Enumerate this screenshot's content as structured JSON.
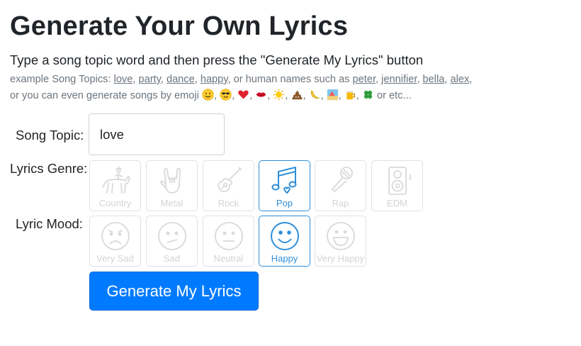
{
  "page": {
    "title": "Generate Your Own Lyrics",
    "instruction": "Type a song topic word and then press the \"Generate My Lyrics\" button",
    "examples_prefix": "example Song Topics:",
    "example_topics": [
      "love",
      "party",
      "dance",
      "happy"
    ],
    "human_names_text": ", or human names such as",
    "example_names": [
      "peter",
      "jennifier",
      "bella",
      "alex"
    ],
    "emoji_text": "or you can even generate songs by emoji",
    "emoji_names": [
      "smiling-face-emoji",
      "sunglasses-face-emoji",
      "heart-emoji",
      "lips-emoji",
      "sun-emoji",
      "poop-emoji",
      "banana-emoji",
      "beach-emoji",
      "beer-emoji",
      "four-leaf-clover-emoji"
    ],
    "etc_text": "or etc..."
  },
  "form": {
    "topic_label": "Song Topic:",
    "topic_value": "love",
    "genre_label": "Lyrics Genre:",
    "genres": [
      {
        "label": "Country",
        "icon": "cowboy-horse-icon",
        "selected": false
      },
      {
        "label": "Metal",
        "icon": "rock-hand-icon",
        "selected": false
      },
      {
        "label": "Rock",
        "icon": "guitar-icon",
        "selected": false
      },
      {
        "label": "Pop",
        "icon": "music-notes-icon",
        "selected": true
      },
      {
        "label": "Rap",
        "icon": "microphone-icon",
        "selected": false
      },
      {
        "label": "EDM",
        "icon": "speaker-icon",
        "selected": false
      }
    ],
    "mood_label": "Lyric Mood:",
    "moods": [
      {
        "label": "Very Sad",
        "icon": "very-sad-face-icon",
        "selected": false
      },
      {
        "label": "Sad",
        "icon": "sad-face-icon",
        "selected": false
      },
      {
        "label": "Neutral",
        "icon": "neutral-face-icon",
        "selected": false
      },
      {
        "label": "Happy",
        "icon": "happy-face-icon",
        "selected": true
      },
      {
        "label": "Very Happy",
        "icon": "very-happy-face-icon",
        "selected": false
      }
    ],
    "submit_label": "Generate My Lyrics"
  },
  "colors": {
    "primary_button": "#007bff",
    "selected_accent": "#2f8fd8",
    "unselected_icon": "#d9d9d9",
    "muted_text": "#6c757d"
  }
}
